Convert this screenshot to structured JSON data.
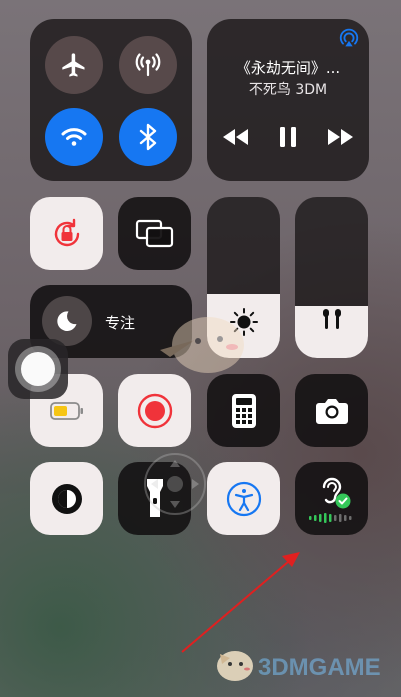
{
  "connectivity": {
    "airplane": "airplane-icon",
    "cellular": "cellular-icon",
    "wifi": "wifi-icon",
    "bluetooth": "bluetooth-icon",
    "active_color": "#1677f2"
  },
  "media": {
    "title": "《永劫无间》...",
    "artist": "不死鸟 3DM",
    "airplay": "airplay-icon"
  },
  "focus": {
    "label": "专注"
  },
  "brightness": {
    "level": 0.4
  },
  "volume": {
    "level": 0.32
  },
  "buttons": {
    "orientation_lock": "orientation-lock-icon",
    "screen_mirroring": "screen-mirroring-icon",
    "low_power": "battery-icon",
    "screen_recording": "record-icon",
    "calculator": "calculator-icon",
    "camera": "camera-icon",
    "dark_mode": "dark-mode-icon",
    "flashlight": "flashlight-icon",
    "accessibility": "accessibility-icon",
    "hearing": "hearing-icon"
  },
  "watermark": {
    "text": "3DMGAME"
  }
}
